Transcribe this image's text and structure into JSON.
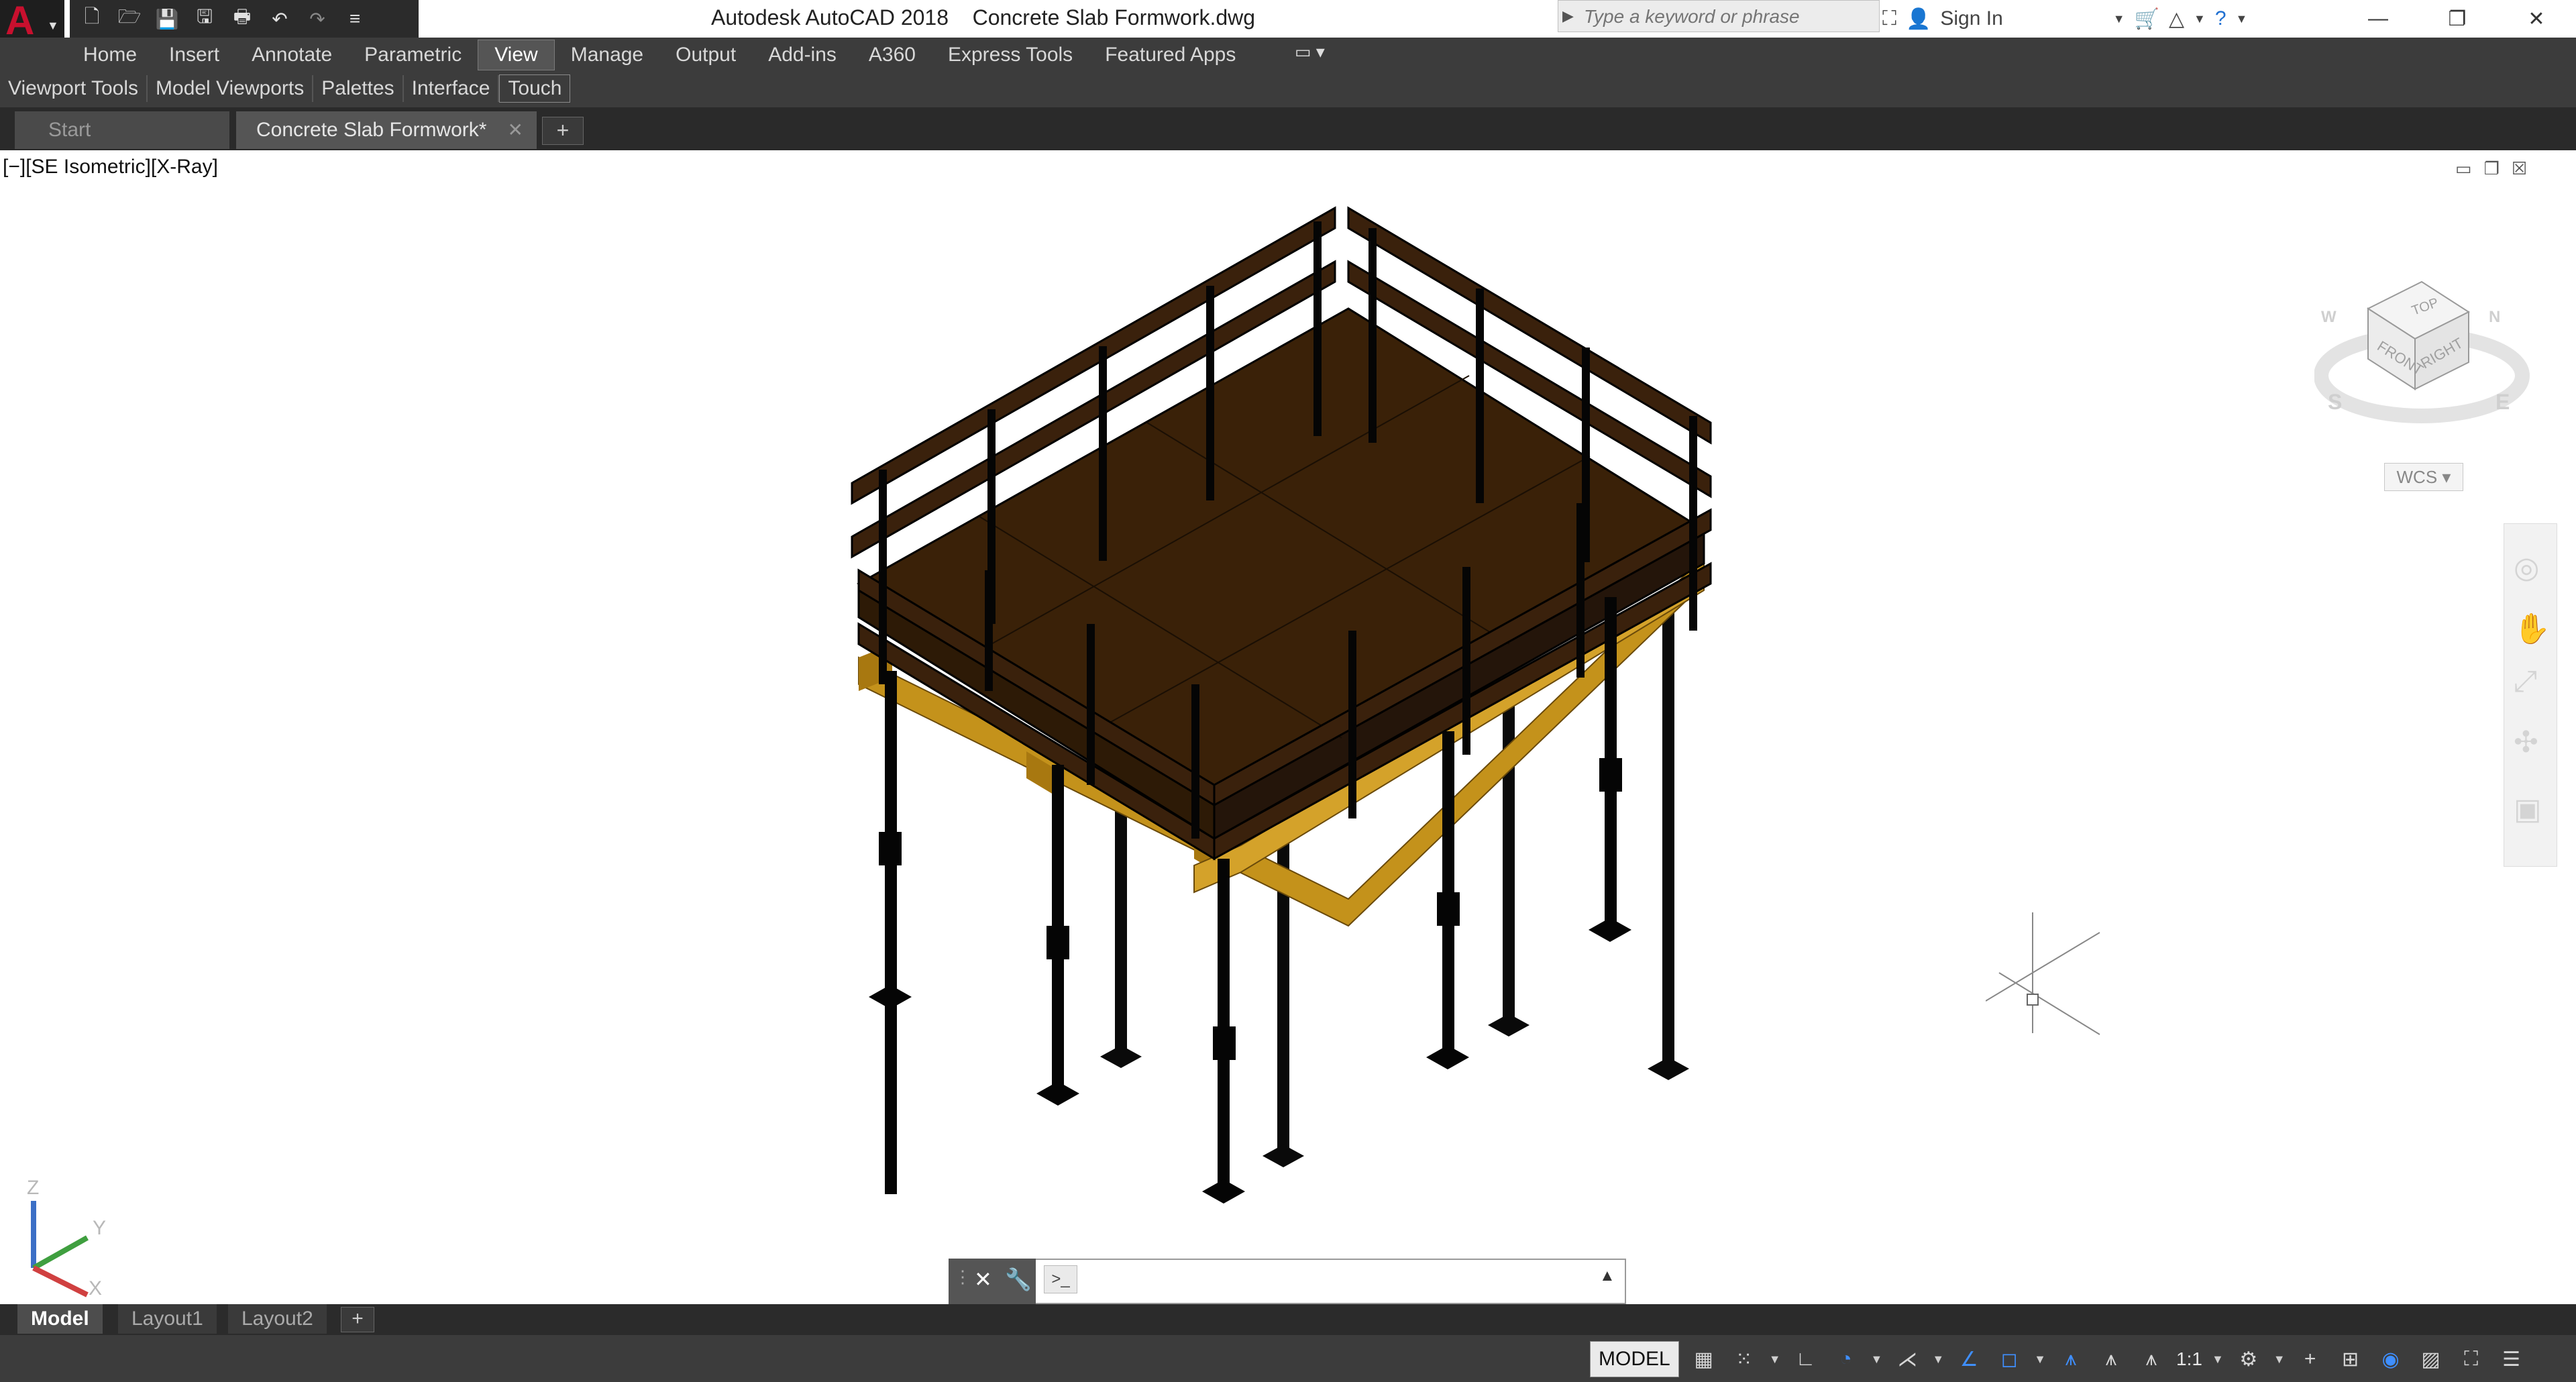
{
  "title_bar": {
    "title": "Autodesk AutoCAD 2018    Concrete Slab Formwork.dwg",
    "search_placeholder": "Type a keyword or phrase",
    "sign_in": "Sign In"
  },
  "qat": {
    "icons": [
      "new-icon",
      "open-icon",
      "save-icon",
      "save-as-icon",
      "plot-icon",
      "undo-icon",
      "redo-icon",
      "customize-icon"
    ]
  },
  "ribbon": {
    "tabs": [
      "Home",
      "Insert",
      "Annotate",
      "Parametric",
      "View",
      "Manage",
      "Output",
      "Add-ins",
      "A360",
      "Express Tools",
      "Featured Apps"
    ],
    "active_tab": "View",
    "panels": [
      "Viewport Tools",
      "Model Viewports",
      "Palettes",
      "Interface",
      "Touch"
    ]
  },
  "file_tabs": {
    "start": "Start",
    "document": "Concrete Slab Formwork*"
  },
  "viewport": {
    "label": "[−][SE Isometric][X-Ray]",
    "wcs": "WCS",
    "viewcube": {
      "top": "TOP",
      "front": "FRONT",
      "right": "RIGHT",
      "compass": [
        "S",
        "E",
        "W",
        "N"
      ]
    },
    "ucs_axes": [
      "Z",
      "Y",
      "X"
    ]
  },
  "layout_tabs": [
    "Model",
    "Layout1",
    "Layout2"
  ],
  "status_bar": {
    "model": "MODEL",
    "scale": "1:1"
  },
  "colors": {
    "slab": "#3a2108",
    "beam": "#c4921b",
    "rail": "#3a210c",
    "prop": "#0a0a0a",
    "ribbon": "#3c3c3c",
    "accent": "#3f8fff"
  }
}
